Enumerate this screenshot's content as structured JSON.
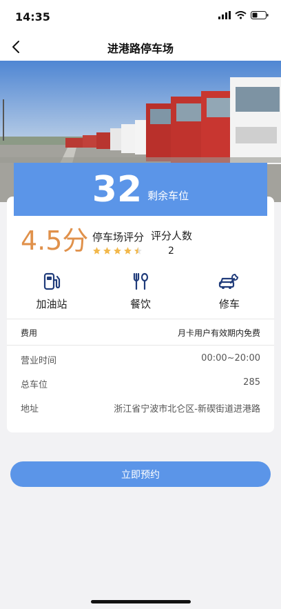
{
  "status_bar": {
    "time": "14:35"
  },
  "header": {
    "title": "进港路停车场"
  },
  "availability": {
    "count": "32",
    "label": "剩余车位"
  },
  "rating": {
    "score": "4.5分",
    "score_title": "停车场评分",
    "stars": 4.5,
    "raters_title": "评分人数",
    "raters_count": "2"
  },
  "facilities": [
    {
      "label": "加油站",
      "icon": "fuel-pump-icon"
    },
    {
      "label": "餐饮",
      "icon": "fork-spoon-icon"
    },
    {
      "label": "修车",
      "icon": "car-repair-icon"
    }
  ],
  "details": {
    "fee_label": "费用",
    "fee_value": "月卡用户有效期内免费",
    "hours_label": "营业时间",
    "hours_value": "00:00~20:00",
    "total_label": "总车位",
    "total_value": "285",
    "address_label": "地址",
    "address_value": "浙江省宁波市北仑区-新碶街道进港路"
  },
  "actions": {
    "reserve_label": "立即预约"
  },
  "colors": {
    "accent": "#5b95e8",
    "score": "#e0914b",
    "star": "#f2b84b",
    "icon": "#1f3b7a"
  }
}
